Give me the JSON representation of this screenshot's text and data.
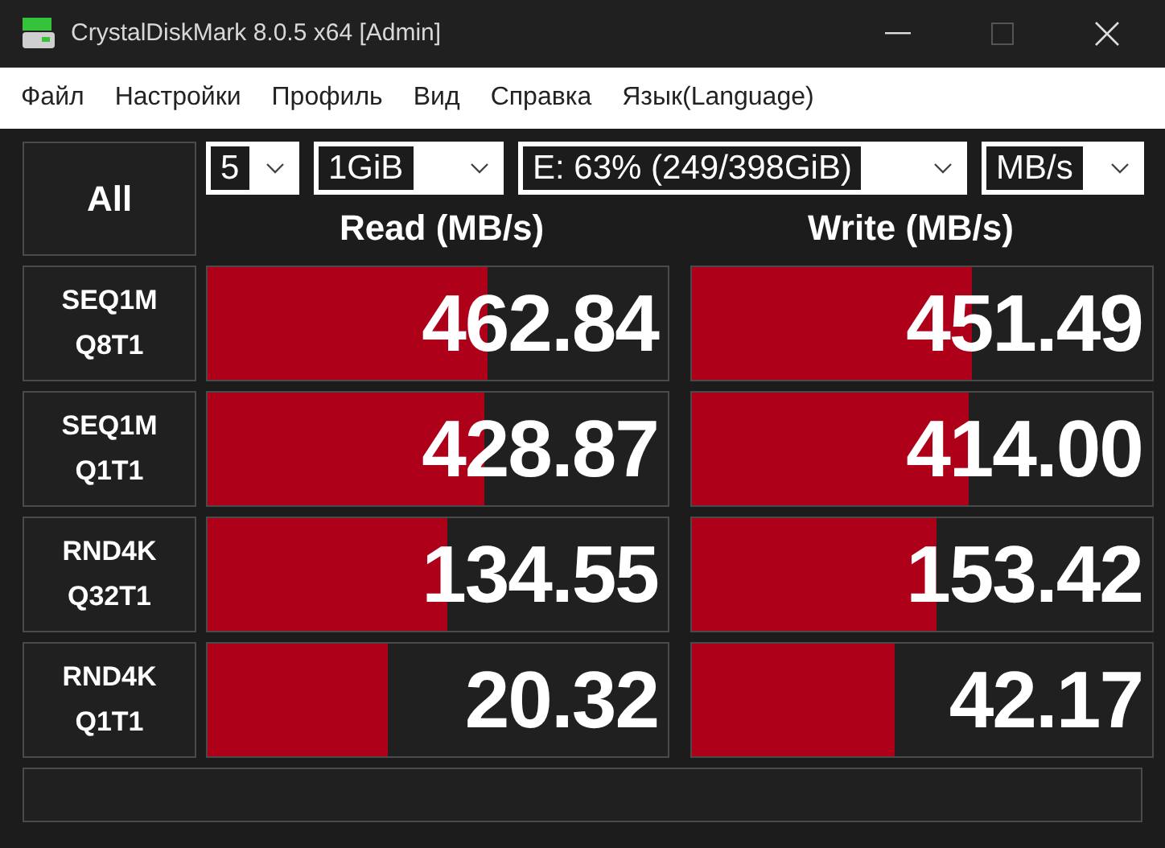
{
  "window": {
    "title": "CrystalDiskMark 8.0.5 x64 [Admin]"
  },
  "menu": [
    "Файл",
    "Настройки",
    "Профиль",
    "Вид",
    "Справка",
    "Язык(Language)"
  ],
  "all_button": "All",
  "selects": [
    {
      "value": "5"
    },
    {
      "value": "1GiB"
    },
    {
      "value": "E: 63% (249/398GiB)"
    },
    {
      "value": "MB/s"
    }
  ],
  "headers": [
    "Read (MB/s)",
    "Write (MB/s)"
  ],
  "tests": [
    {
      "label": [
        "SEQ1M",
        "Q8T1"
      ],
      "read": {
        "value": "462.84",
        "level": 0.61
      },
      "write": {
        "value": "451.49",
        "level": 0.61
      }
    },
    {
      "label": [
        "SEQ1M",
        "Q1T1"
      ],
      "read": {
        "value": "428.87",
        "level": 0.6
      },
      "write": {
        "value": "414.00",
        "level": 0.6
      }
    },
    {
      "label": [
        "RND4K",
        "Q32T1"
      ],
      "read": {
        "value": "134.55",
        "level": 0.52
      },
      "write": {
        "value": "153.42",
        "level": 0.53
      }
    },
    {
      "label": [
        "RND4K",
        "Q1T1"
      ],
      "read": {
        "value": "20.32",
        "level": 0.39
      },
      "write": {
        "value": "42.17",
        "level": 0.44
      }
    }
  ]
}
